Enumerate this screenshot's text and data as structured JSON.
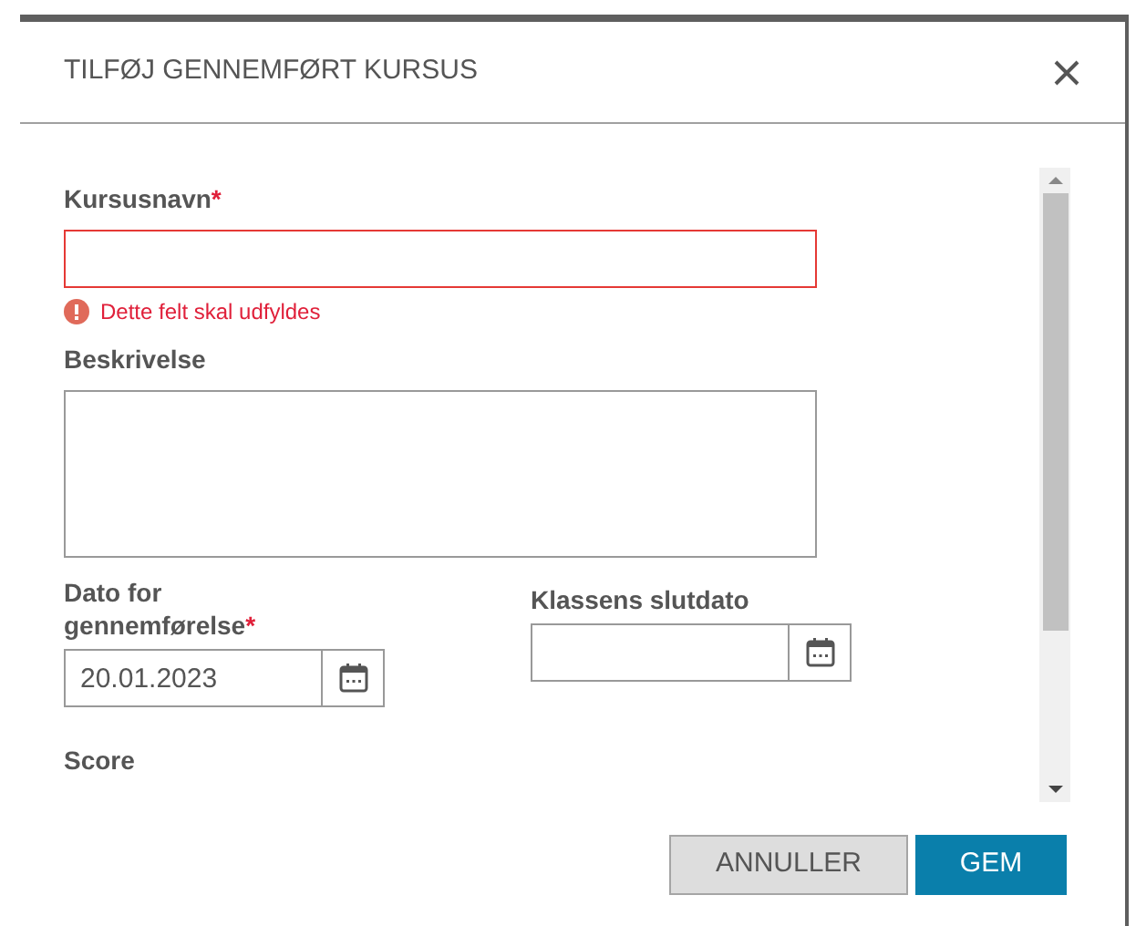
{
  "dialog": {
    "title": "TILFØJ GENNEMFØRT KURSUS"
  },
  "fields": [
    {
      "kind": "text",
      "label": "Kursusnavn",
      "required_mark": "*",
      "invalid": true,
      "error": "Dette felt skal udfyldes"
    },
    {
      "kind": "textarea",
      "label": "Beskrivelse",
      "invalid": false
    }
  ],
  "date_fields": [
    {
      "label": "Dato for gennemførelse",
      "required_mark": "*",
      "value": "20.01.2023"
    },
    {
      "label": "Klassens slutdato"
    }
  ],
  "score_label": "Score",
  "buttons": [
    {
      "label": "ANNULLER",
      "kind": "secondary"
    },
    {
      "label": "GEM",
      "kind": "primary"
    }
  ]
}
